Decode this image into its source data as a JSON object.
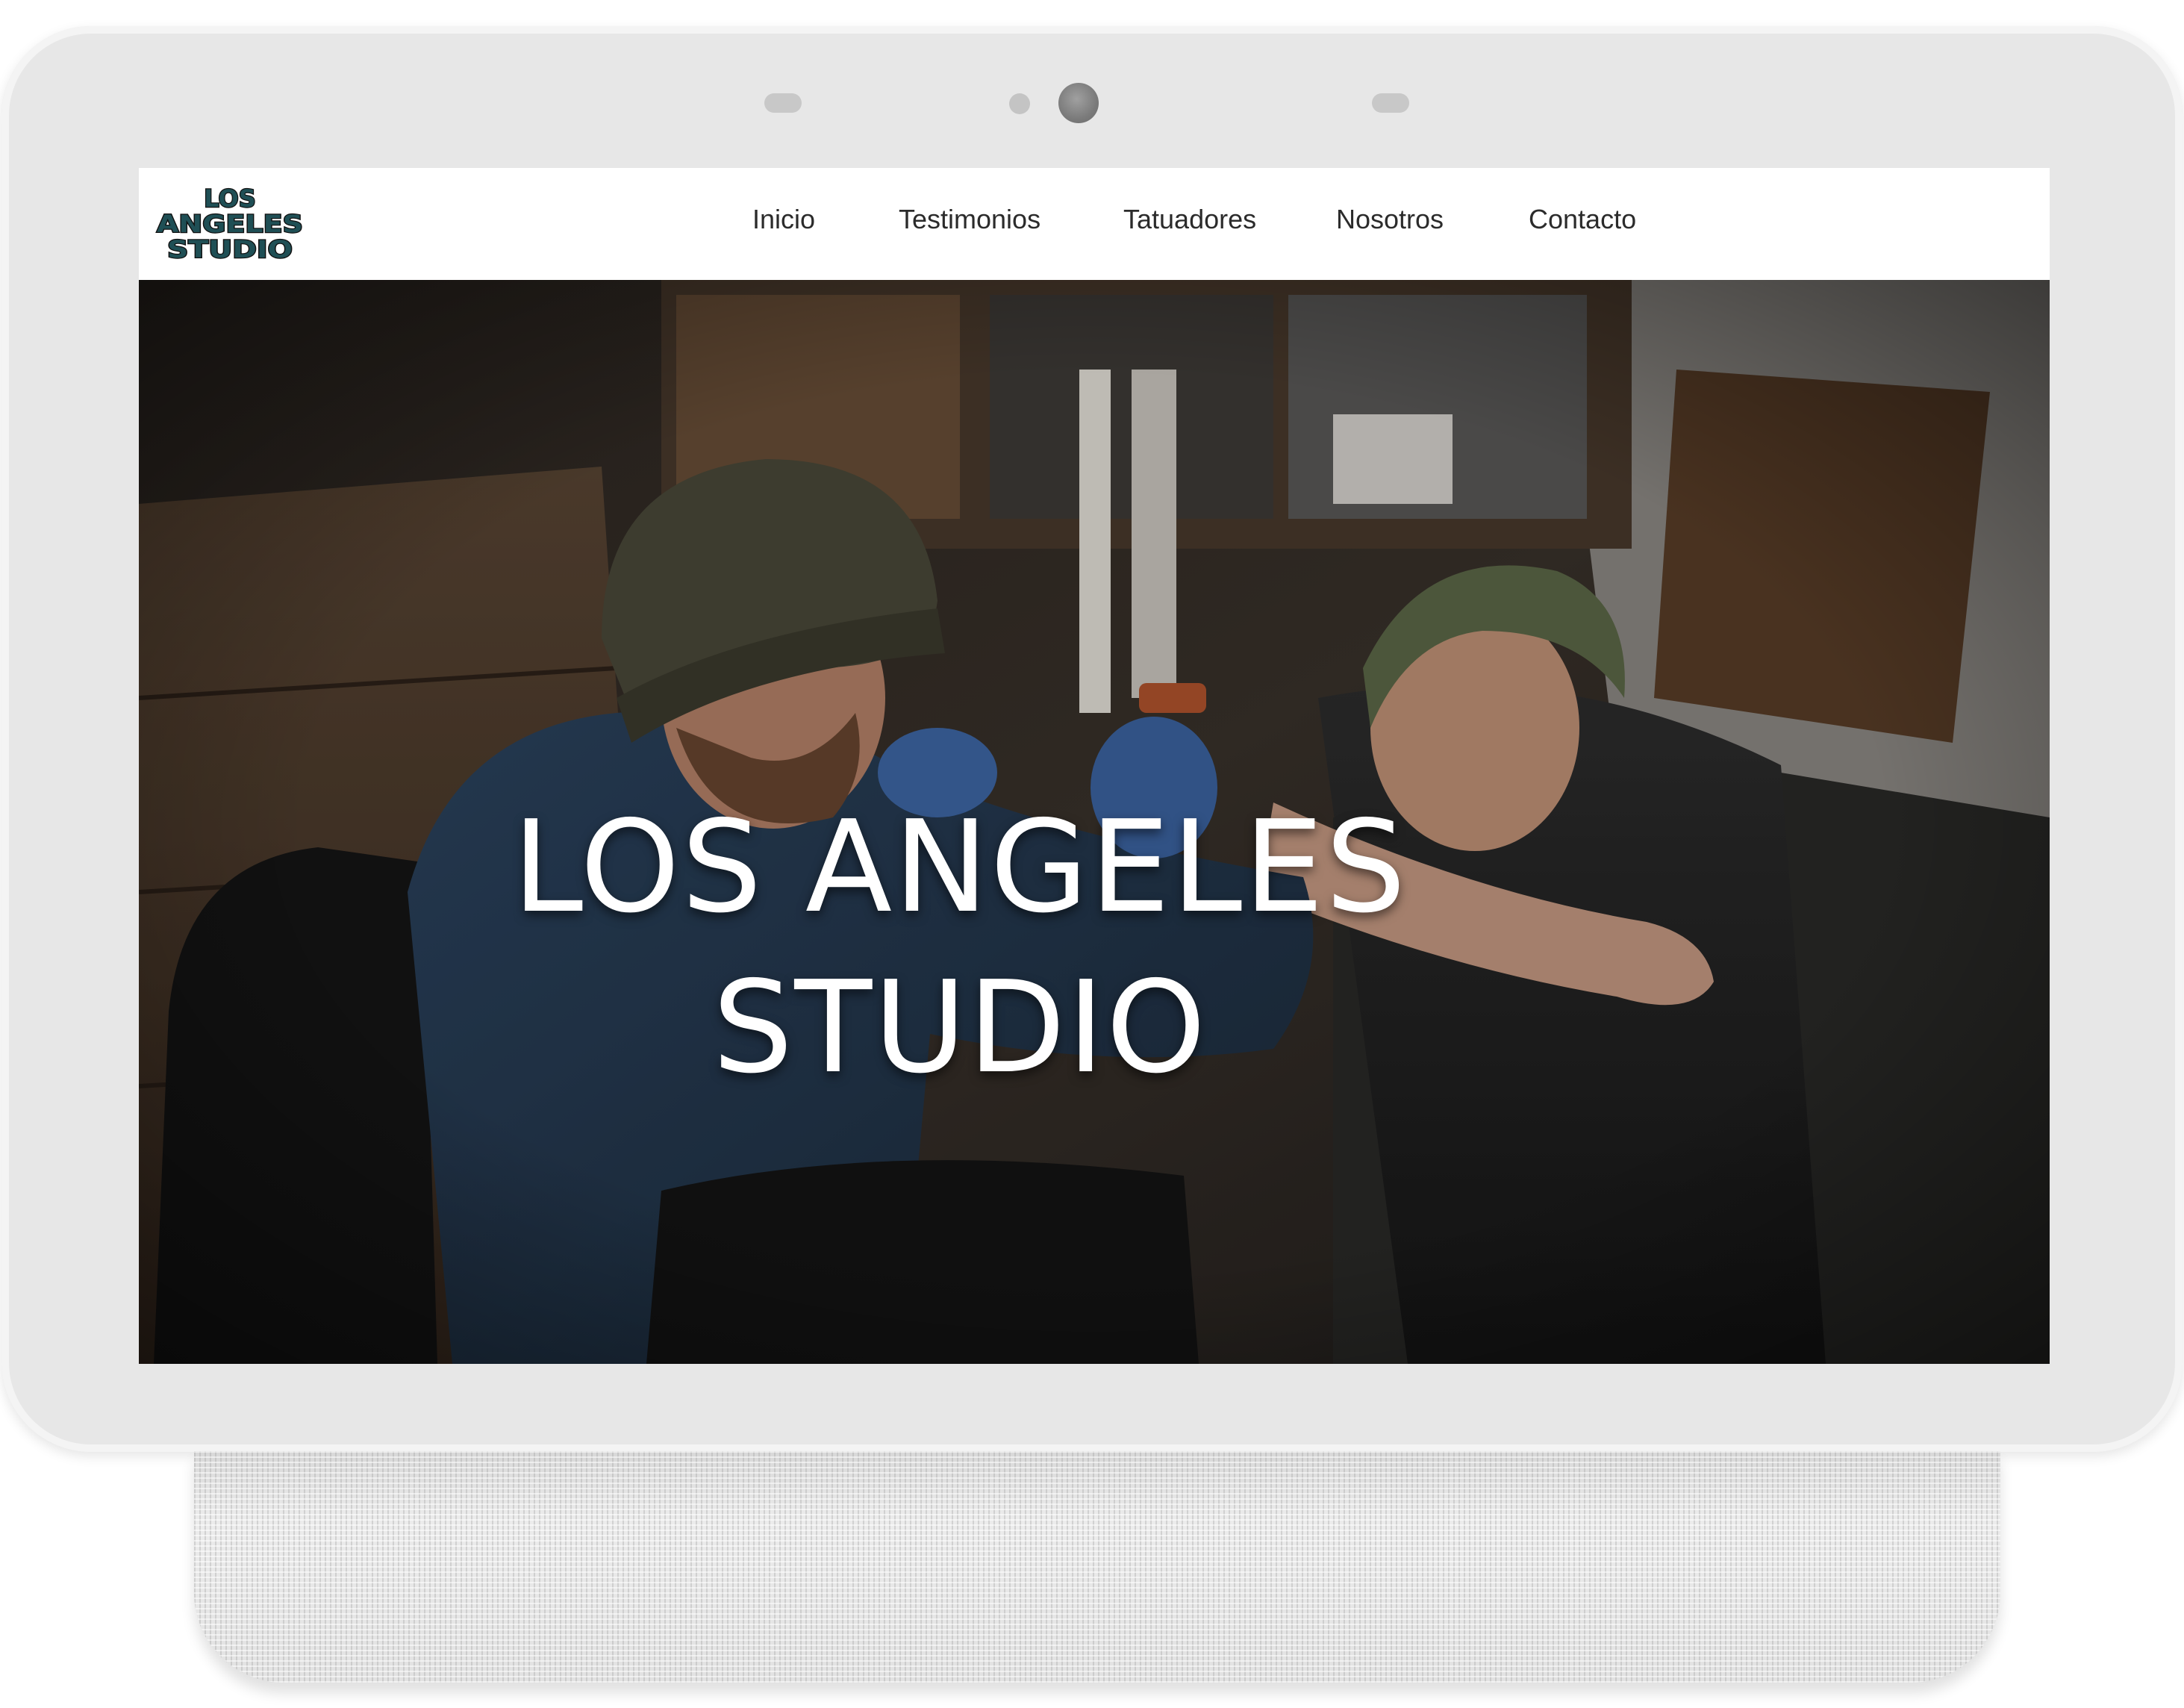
{
  "logo": {
    "lines": [
      "LOS",
      "ANGELES",
      "STUDIO"
    ],
    "fill_color": "#1f4f55",
    "outline_color": "#111111"
  },
  "nav": {
    "items": [
      {
        "label": "Inicio"
      },
      {
        "label": "Testimonios"
      },
      {
        "label": "Tatuadores"
      },
      {
        "label": "Nosotros"
      },
      {
        "label": "Contacto"
      }
    ]
  },
  "hero": {
    "title_line1": "LOS ANGELES",
    "title_line2": "STUDIO",
    "image_subject": "tattoo artist in beanie tattooing a woman's arm"
  },
  "colors": {
    "device_frame": "#e7e7e7",
    "navbar_bg": "#ffffff",
    "hero_text": "#ffffff"
  }
}
